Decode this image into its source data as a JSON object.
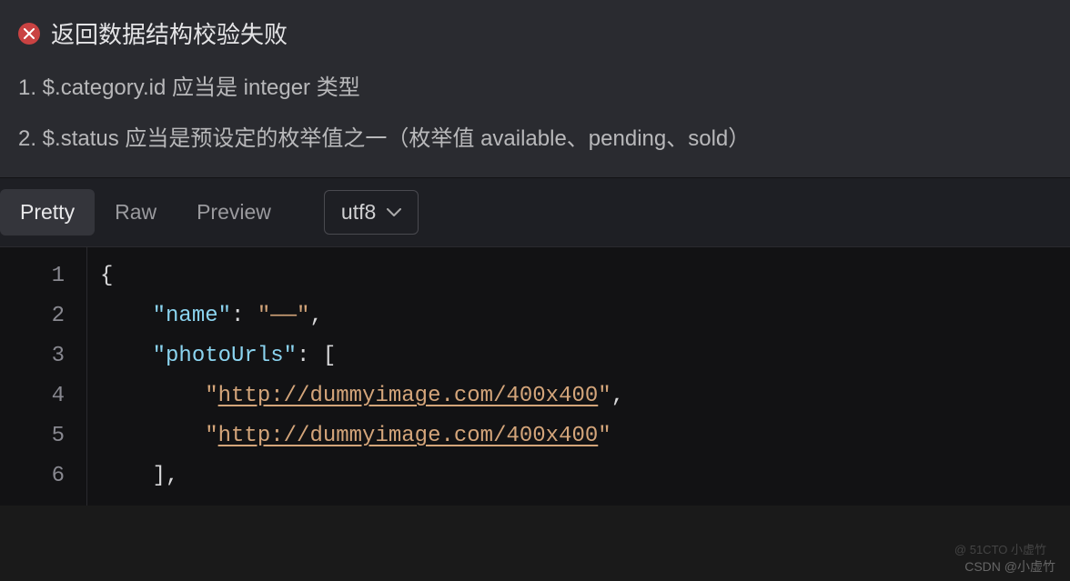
{
  "error": {
    "title": "返回数据结构校验失败",
    "items": [
      "1. $.category.id 应当是 integer 类型",
      "2. $.status 应当是预设定的枚举值之一（枚举值 available、pending、sold）"
    ]
  },
  "tabs": {
    "pretty": "Pretty",
    "raw": "Raw",
    "preview": "Preview"
  },
  "encoding": {
    "label": "utf8"
  },
  "code": {
    "lineNumbers": [
      "1",
      "2",
      "3",
      "4",
      "5",
      "6"
    ],
    "tokens": {
      "brace_open": "{",
      "key_name": "\"name\"",
      "colon_sp": ": ",
      "val_name": "\"——\"",
      "comma": ",",
      "key_photo": "\"photoUrls\"",
      "bracket_open": "[",
      "url1_q1": "\"",
      "url1": "http://dummyimage.com/400x400",
      "url1_q2": "\"",
      "url2_q1": "\"",
      "url2": "http://dummyimage.com/400x400",
      "url2_q2": "\"",
      "bracket_close": "],"
    }
  },
  "watermark": "CSDN @小虚竹",
  "watermark2": "@ 51CTO 小虚竹"
}
